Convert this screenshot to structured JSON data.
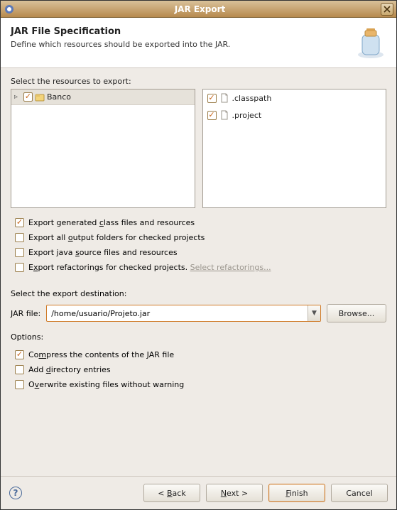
{
  "titlebar": {
    "title": "JAR Export"
  },
  "header": {
    "title": "JAR File Specification",
    "subtitle": "Define which resources should be exported into the JAR."
  },
  "resources": {
    "label": "Select the resources to export:",
    "left": [
      {
        "label": "Banco",
        "checked": true
      }
    ],
    "right": [
      {
        "label": ".classpath",
        "checked": true
      },
      {
        "label": ".project",
        "checked": true
      }
    ]
  },
  "export_opts": {
    "gen_class": {
      "label_pre": "Export generated ",
      "u": "c",
      "label_post": "lass files and resources",
      "checked": true
    },
    "all_out": {
      "label_pre": "Export all ",
      "u": "o",
      "label_post": "utput folders for checked projects",
      "checked": false
    },
    "java_src": {
      "label_pre": "Export java ",
      "u": "s",
      "label_post": "ource files and resources",
      "checked": false
    },
    "refactor": {
      "label_pre": "E",
      "u": "x",
      "label_post": "port refactorings for checked projects.",
      "checked": false,
      "link": "Select refactorings..."
    }
  },
  "destination": {
    "section_label": "Select the export destination:",
    "label_pre": "",
    "label_u": "J",
    "label_post": "AR file:",
    "value": "/home/usuario/Projeto.jar",
    "browse": "Browse..."
  },
  "options": {
    "heading": "Options:",
    "compress": {
      "label_pre": "Co",
      "u": "m",
      "label_post": "press the contents of the JAR file",
      "checked": true
    },
    "add_dir": {
      "label_pre": "Add ",
      "u": "d",
      "label_post": "irectory entries",
      "checked": false
    },
    "overwrite": {
      "label_pre": "O",
      "u": "v",
      "label_post": "erwrite existing files without warning",
      "checked": false
    }
  },
  "footer": {
    "back": "< Back",
    "next": "Next >",
    "finish": "Finish",
    "cancel": "Cancel"
  }
}
